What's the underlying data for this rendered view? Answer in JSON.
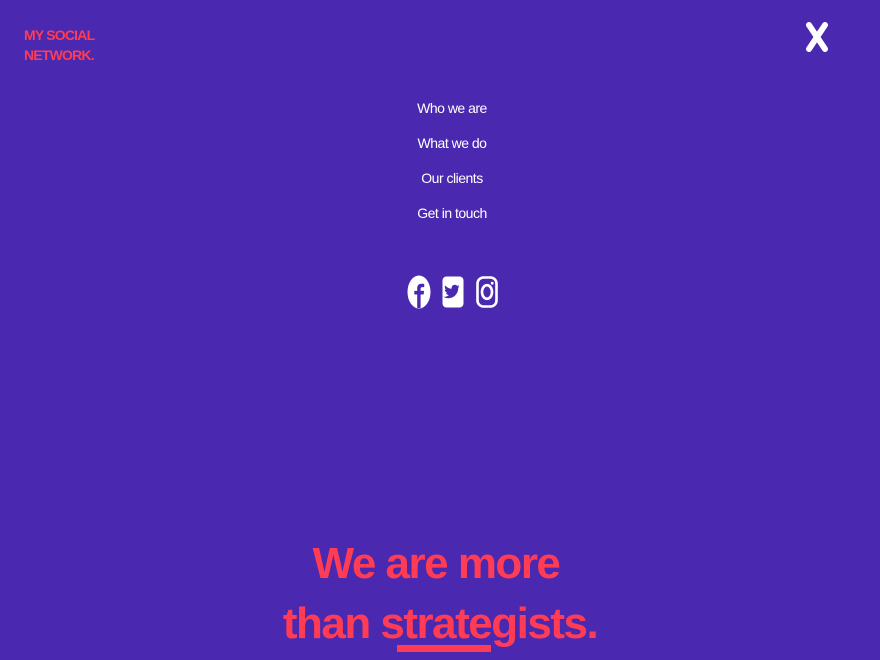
{
  "brand": {
    "line1": "MY SOCIAL",
    "line2": "NETWORK.",
    "color": "#ff3c54"
  },
  "close": {
    "icon": "close-icon"
  },
  "nav": {
    "items": [
      {
        "label": "Who we are"
      },
      {
        "label": "What we do"
      },
      {
        "label": "Our clients"
      },
      {
        "label": "Get in touch"
      }
    ]
  },
  "social": {
    "icons": [
      "facebook-icon",
      "twitter-icon",
      "instagram-icon"
    ]
  },
  "hero": {
    "line1": "We are more",
    "line2": "than strategists."
  },
  "colors": {
    "background": "#4a28b0",
    "accent": "#ff3c54",
    "text": "#ffffff"
  }
}
